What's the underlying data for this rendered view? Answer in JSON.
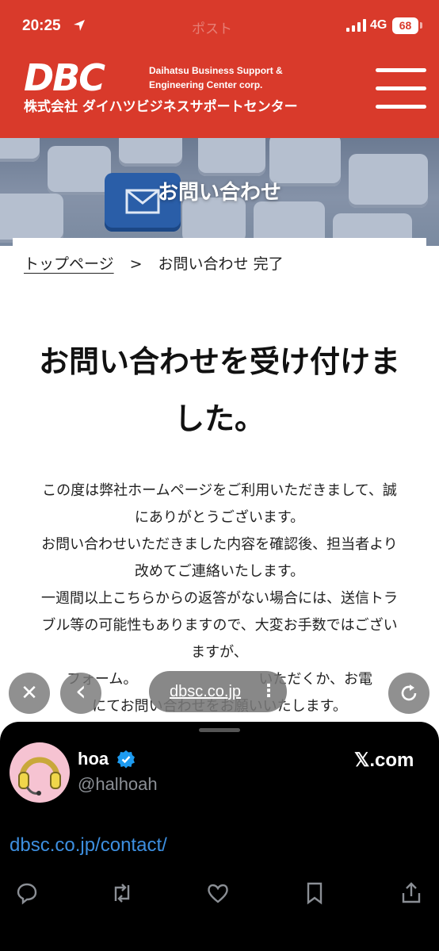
{
  "status_bar": {
    "time": "20:25",
    "faded_title": "ポスト",
    "network": "4G",
    "battery": "68"
  },
  "site": {
    "logo_text": "DBC",
    "logo_en_line1": "Daihatsu Business Support &",
    "logo_en_line2": "Engineering Center corp.",
    "logo_jp": "株式会社 ダイハツビジネスサポートセンター",
    "hero_title": "お問い合わせ"
  },
  "breadcrumb": {
    "home": "トップページ",
    "separator": ">",
    "current": "お問い合わせ 完了"
  },
  "main": {
    "heading_line1": "お問い合わせを受け付けま",
    "heading_line2": "した。",
    "body_lines": [
      "この度は弊社ホームページをご利用いただきまして、誠",
      "にありがとうございます。",
      "お問い合わせいただきました内容を確認後、担当者より",
      "改めてご連絡いたします。",
      "一週間以上こちらからの返答がない場合には、送信トラ",
      "ブル等の可能性もありますので、大変お手数ではござい",
      "ますが、",
      "フォーム。　　　　　　　　　いただくか、お電",
      "にてお問い合わせをお願いいたします。"
    ]
  },
  "browser": {
    "url": "dbsc.co.jp",
    "more": "⋮",
    "close": "✕",
    "back": "‹"
  },
  "tweet": {
    "name": "hoa",
    "handle": "@halhoah",
    "source": "𝕏.com",
    "link": "dbsc.co.jp/contact/"
  },
  "colors": {
    "brand_red": "#d93a2b",
    "link_blue": "#3d8fe0",
    "sheet_bg": "#000000"
  }
}
